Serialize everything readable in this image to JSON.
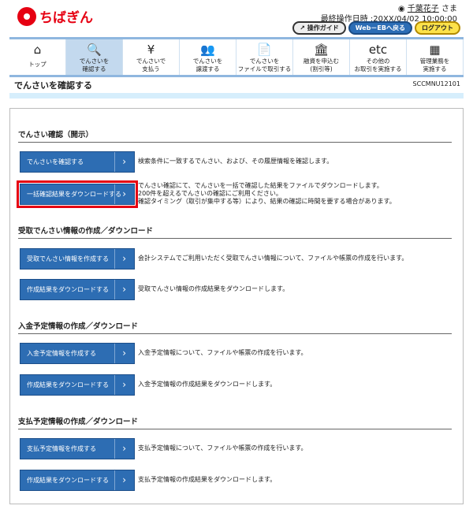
{
  "header": {
    "logo": "ちばぎん",
    "user_name": "千葉花子",
    "user_suffix": "さま",
    "last_op_label": "最終操作日時 :",
    "last_op_value": "20XX/04/02 10:00:00",
    "guide": "操作ガイド",
    "web_eb": "Web－EBへ戻る",
    "logout": "ログアウト"
  },
  "nav": [
    {
      "icon": "home-icon",
      "glyph": "⌂",
      "label": "トップ"
    },
    {
      "icon": "search-icon",
      "glyph": "🔍",
      "label": "でんさいを\n確認する",
      "active": true
    },
    {
      "icon": "pay-icon",
      "glyph": "¥",
      "label": "でんさいで\n支払う"
    },
    {
      "icon": "transfer-icon",
      "glyph": "👥",
      "label": "でんさいを\n譲渡する"
    },
    {
      "icon": "file-icon",
      "glyph": "📄",
      "label": "でんさいを\nファイルで取引する"
    },
    {
      "icon": "bank-icon",
      "glyph": "🏛",
      "label": "融資を申込む\n(割引等)"
    },
    {
      "icon": "etc-icon",
      "glyph": "etc",
      "label": "その他の\nお取引を実施する"
    },
    {
      "icon": "admin-icon",
      "glyph": "▦",
      "label": "管理業務を\n実施する"
    }
  ],
  "page": {
    "title": "でんさいを確認する",
    "code": "SCCMNU12101"
  },
  "sections": [
    {
      "title": "でんさい確認（開示）",
      "items": [
        {
          "button": "でんさいを確認する",
          "desc": "検索条件に一致するでんさい、および、その履歴情報を確認します。"
        },
        {
          "button": "一括確認結果をダウンロードする",
          "desc": "でんさい確認にて、でんさいを一括で確認した結果をファイルでダウンロードします。\n200件を超えるでんさいの確認にご利用ください。\n確認タイミング（取引が集中する等）により、結果の確認に時間を要する場合があります。",
          "highlight": true
        }
      ]
    },
    {
      "title": "受取でんさい情報の作成／ダウンロード",
      "items": [
        {
          "button": "受取でんさい情報を作成する",
          "desc": "会計システムでご利用いただく受取でんさい情報について、ファイルや帳票の作成を行います。"
        },
        {
          "button": "作成結果をダウンロードする",
          "desc": "受取でんさい情報の作成結果をダウンロードします。"
        }
      ]
    },
    {
      "title": "入金予定情報の作成／ダウンロード",
      "items": [
        {
          "button": "入金予定情報を作成する",
          "desc": "入金予定情報について、ファイルや帳票の作成を行います。"
        },
        {
          "button": "作成結果をダウンロードする",
          "desc": "入金予定情報の作成結果をダウンロードします。"
        }
      ]
    },
    {
      "title": "支払予定情報の作成／ダウンロード",
      "items": [
        {
          "button": "支払予定情報を作成する",
          "desc": "支払予定情報について、ファイルや帳票の作成を行います。"
        },
        {
          "button": "作成結果をダウンロードする",
          "desc": "支払予定情報の作成結果をダウンロードします。"
        }
      ]
    }
  ]
}
